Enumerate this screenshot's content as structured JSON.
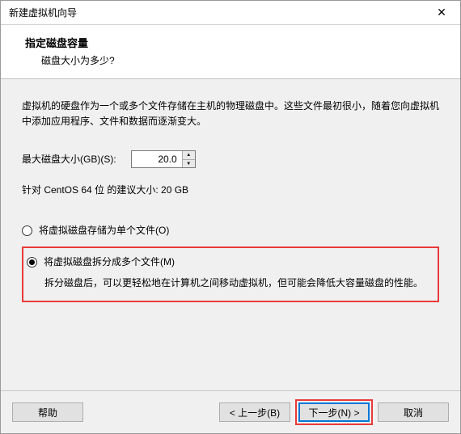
{
  "window": {
    "title": "新建虚拟机向导"
  },
  "header": {
    "title": "指定磁盘容量",
    "subtitle": "磁盘大小为多少?"
  },
  "content": {
    "description": "虚拟机的硬盘作为一个或多个文件存储在主机的物理磁盘中。这些文件最初很小，随着您向虚拟机中添加应用程序、文件和数据而逐渐变大。",
    "size_label": "最大磁盘大小(GB)(S):",
    "size_value": "20.0",
    "recommend": "针对 CentOS 64 位 的建议大小: 20 GB",
    "radio_single": "将虚拟磁盘存储为单个文件(O)",
    "radio_split": "将虚拟磁盘拆分成多个文件(M)",
    "split_desc": "拆分磁盘后，可以更轻松地在计算机之间移动虚拟机，但可能会降低大容量磁盘的性能。"
  },
  "footer": {
    "help": "帮助",
    "back": "< 上一步(B)",
    "next": "下一步(N) >",
    "cancel": "取消"
  }
}
